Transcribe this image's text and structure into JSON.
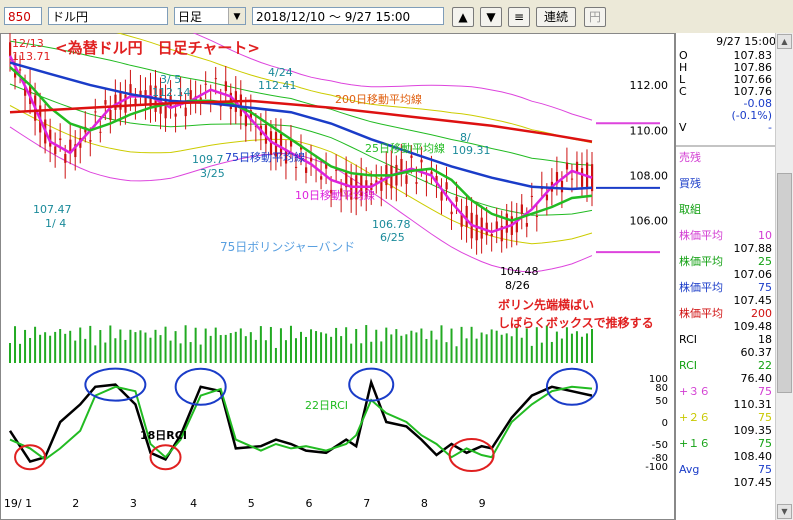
{
  "toolbar": {
    "code": "850",
    "pair": "ドル円",
    "period": "日足",
    "range": "2018/12/10 ～ 9/27 15:00",
    "up_label": "▲",
    "down_label": "▼",
    "menu_label": "≡",
    "continuous_label": "連続",
    "yen_label": "円"
  },
  "info": {
    "datetime": "9/27 15:00",
    "rows": [
      {
        "k": "O",
        "v": "107.83"
      },
      {
        "k": "H",
        "v": "107.86"
      },
      {
        "k": "L",
        "v": "107.66"
      },
      {
        "k": "C",
        "v": "107.76"
      },
      {
        "k": "",
        "v": "-0.08"
      },
      {
        "k": "",
        "v": "(-0.1%)"
      },
      {
        "k": "V",
        "v": "-"
      }
    ],
    "price_axis": [
      "112.00",
      "110.00",
      "108.00",
      "106.00"
    ],
    "rci_axis": [
      "100",
      "80",
      "50",
      "0",
      "-50",
      "-80",
      "-100"
    ]
  },
  "legend": [
    {
      "label": "売残",
      "value": "",
      "color": "#d23cd2"
    },
    {
      "label": "買残",
      "value": "",
      "color": "#1a3cc8"
    },
    {
      "label": "取組",
      "value": "",
      "color": "#12a012"
    },
    {
      "label": "株価平均",
      "param": "10",
      "value": "107.88",
      "color": "#d23cd2"
    },
    {
      "label": "株価平均",
      "param": "25",
      "value": "107.06",
      "color": "#12a012"
    },
    {
      "label": "株価平均",
      "param": "75",
      "value": "107.45",
      "color": "#1a3cc8"
    },
    {
      "label": "株価平均",
      "param": "200",
      "value": "109.48",
      "color": "#d01010"
    },
    {
      "label": "RCI",
      "param": "18",
      "value": "60.37",
      "color": "#000000"
    },
    {
      "label": "RCI",
      "param": "22",
      "value": "76.40",
      "color": "#12a012"
    },
    {
      "label": "+３６",
      "param": "75",
      "value": "110.31",
      "color": "#d23cd2"
    },
    {
      "label": "+２６",
      "param": "75",
      "value": "109.35",
      "color": "#c8c800"
    },
    {
      "label": "+１６",
      "param": "75",
      "value": "108.40",
      "color": "#12a012"
    },
    {
      "label": "Avg",
      "param": "75",
      "value": "107.45",
      "color": "#1a3cc8"
    }
  ],
  "annotations": {
    "title": "<為替ドル円　日足チャート>",
    "top_date": "12/13",
    "top_price": "113.71",
    "ma200": "200日移動平均線",
    "ma75": "75日移動平均線",
    "ma25": "25日移動平均線",
    "ma10": "10日移動平均線",
    "boll": "75日ボリンジャーバンド",
    "p1_val": "107.47",
    "p1_date": "1/ 4",
    "p2_val": "112.14",
    "p2_date": "3/ 5",
    "p3_val": "109.7",
    "p3_date": "3/25",
    "p4_val": "112.41",
    "p4_date": "4/24",
    "p5_val": "106.78",
    "p5_date": "6/25",
    "p6_val": "109.31",
    "p6_date": "8/",
    "p7_val": "104.48",
    "p7_date": "8/26",
    "comment1": "ボリン先端横ばい",
    "comment2": "しばらくボックスで推移する",
    "rci18": "18日RCI",
    "rci22": "22日RCI"
  },
  "colors": {
    "ma10": "#dd22dd",
    "ma25": "#22bb22",
    "ma75": "#1a3cc8",
    "ma200": "#dd1111",
    "band_outer": "#dd44dd",
    "band_mid": "#cccc00",
    "band_inner": "#22bb22",
    "candle": "#cc1111",
    "volume": "#22aa22",
    "annot_red": "#e02020",
    "rci18": "#000000",
    "rci22": "#22bb22"
  },
  "chart_data": [
    {
      "type": "line",
      "title": "<為替ドル円　日足チャート>",
      "x_tick_labels": [
        "19/ 1",
        "2",
        "3",
        "4",
        "5",
        "6",
        "7",
        "8",
        "9"
      ],
      "ylim": [
        103.5,
        114.0
      ],
      "y_tick_labels": [
        "112.00",
        "110.00",
        "108.00",
        "106.00"
      ],
      "series": [
        {
          "name": "株価平均 10",
          "points": [
            [
              0,
              113.3
            ],
            [
              8,
              111.5
            ],
            [
              16,
              109.5
            ],
            [
              24,
              109.0
            ],
            [
              32,
              110.0
            ],
            [
              40,
              111.0
            ],
            [
              48,
              111.5
            ],
            [
              56,
              111.5
            ],
            [
              64,
              111.0
            ],
            [
              72,
              111.3
            ],
            [
              80,
              111.8
            ],
            [
              88,
              111.5
            ],
            [
              96,
              110.5
            ],
            [
              104,
              109.5
            ],
            [
              112,
              109.0
            ],
            [
              120,
              108.5
            ],
            [
              128,
              107.8
            ],
            [
              136,
              107.5
            ],
            [
              144,
              107.5
            ],
            [
              152,
              108.0
            ],
            [
              160,
              108.3
            ],
            [
              168,
              108.0
            ],
            [
              176,
              106.8
            ],
            [
              184,
              105.8
            ],
            [
              192,
              105.5
            ],
            [
              200,
              105.8
            ],
            [
              208,
              106.5
            ],
            [
              216,
              107.5
            ],
            [
              224,
              108.2
            ],
            [
              232,
              107.9
            ]
          ]
        },
        {
          "name": "株価平均 25",
          "points": [
            [
              0,
              112.8
            ],
            [
              8,
              112.0
            ],
            [
              16,
              111.0
            ],
            [
              24,
              110.3
            ],
            [
              32,
              110.0
            ],
            [
              40,
              110.3
            ],
            [
              48,
              110.7
            ],
            [
              56,
              111.0
            ],
            [
              64,
              111.2
            ],
            [
              72,
              111.3
            ],
            [
              80,
              111.3
            ],
            [
              88,
              111.2
            ],
            [
              96,
              110.8
            ],
            [
              104,
              110.2
            ],
            [
              112,
              109.6
            ],
            [
              120,
              109.0
            ],
            [
              128,
              108.4
            ],
            [
              136,
              108.1
            ],
            [
              144,
              108.0
            ],
            [
              152,
              108.0
            ],
            [
              160,
              108.2
            ],
            [
              168,
              108.3
            ],
            [
              176,
              107.8
            ],
            [
              184,
              106.9
            ],
            [
              192,
              106.3
            ],
            [
              200,
              106.0
            ],
            [
              208,
              106.3
            ],
            [
              216,
              106.6
            ],
            [
              224,
              107.0
            ],
            [
              232,
              107.1
            ]
          ]
        },
        {
          "name": "株価平均 75",
          "points": [
            [
              0,
              113.0
            ],
            [
              16,
              112.5
            ],
            [
              32,
              112.0
            ],
            [
              48,
              111.6
            ],
            [
              64,
              111.3
            ],
            [
              80,
              111.2
            ],
            [
              96,
              111.0
            ],
            [
              112,
              110.8
            ],
            [
              128,
              110.3
            ],
            [
              144,
              109.6
            ],
            [
              160,
              109.0
            ],
            [
              176,
              108.4
            ],
            [
              192,
              107.9
            ],
            [
              208,
              107.5
            ],
            [
              224,
              107.4
            ],
            [
              232,
              107.45
            ]
          ]
        },
        {
          "name": "株価平均 200",
          "points": [
            [
              0,
              110.8
            ],
            [
              32,
              111.0
            ],
            [
              64,
              111.2
            ],
            [
              96,
              111.3
            ],
            [
              128,
              111.0
            ],
            [
              160,
              110.6
            ],
            [
              192,
              110.2
            ],
            [
              216,
              109.8
            ],
            [
              232,
              109.5
            ]
          ]
        }
      ]
    },
    {
      "type": "line",
      "ylim": [
        -100,
        100
      ],
      "y_tick_labels": [
        "100",
        "80",
        "50",
        "0",
        "-50",
        "-80",
        "-100"
      ],
      "series": [
        {
          "name": "18日RCI",
          "points": [
            [
              0,
              -20
            ],
            [
              8,
              -90
            ],
            [
              14,
              -80
            ],
            [
              20,
              0
            ],
            [
              28,
              40
            ],
            [
              34,
              80
            ],
            [
              42,
              85
            ],
            [
              50,
              40
            ],
            [
              56,
              -70
            ],
            [
              62,
              -85
            ],
            [
              68,
              -30
            ],
            [
              76,
              80
            ],
            [
              84,
              70
            ],
            [
              90,
              -60
            ],
            [
              100,
              -55
            ],
            [
              106,
              -40
            ],
            [
              112,
              -50
            ],
            [
              118,
              -65
            ],
            [
              126,
              -70
            ],
            [
              134,
              -40
            ],
            [
              138,
              -55
            ],
            [
              144,
              90
            ],
            [
              150,
              0
            ],
            [
              158,
              -10
            ],
            [
              164,
              -40
            ],
            [
              170,
              -75
            ],
            [
              176,
              -50
            ],
            [
              182,
              -70
            ],
            [
              188,
              -55
            ],
            [
              192,
              -60
            ],
            [
              200,
              10
            ],
            [
              208,
              60
            ],
            [
              216,
              80
            ],
            [
              224,
              70
            ],
            [
              232,
              60
            ]
          ]
        },
        {
          "name": "22日RCI",
          "points": [
            [
              0,
              -40
            ],
            [
              8,
              -60
            ],
            [
              14,
              -85
            ],
            [
              20,
              -60
            ],
            [
              28,
              -20
            ],
            [
              34,
              60
            ],
            [
              42,
              80
            ],
            [
              50,
              70
            ],
            [
              56,
              -50
            ],
            [
              62,
              -80
            ],
            [
              68,
              -40
            ],
            [
              76,
              60
            ],
            [
              84,
              75
            ],
            [
              90,
              -40
            ],
            [
              100,
              -65
            ],
            [
              106,
              -50
            ],
            [
              112,
              -60
            ],
            [
              118,
              -55
            ],
            [
              126,
              -65
            ],
            [
              134,
              -50
            ],
            [
              138,
              -30
            ],
            [
              144,
              50
            ],
            [
              150,
              20
            ],
            [
              158,
              0
            ],
            [
              164,
              -30
            ],
            [
              170,
              -50
            ],
            [
              176,
              -80
            ],
            [
              182,
              -60
            ],
            [
              188,
              -75
            ],
            [
              192,
              -80
            ],
            [
              200,
              0
            ],
            [
              208,
              40
            ],
            [
              216,
              70
            ],
            [
              224,
              80
            ],
            [
              232,
              76
            ]
          ]
        }
      ]
    }
  ]
}
